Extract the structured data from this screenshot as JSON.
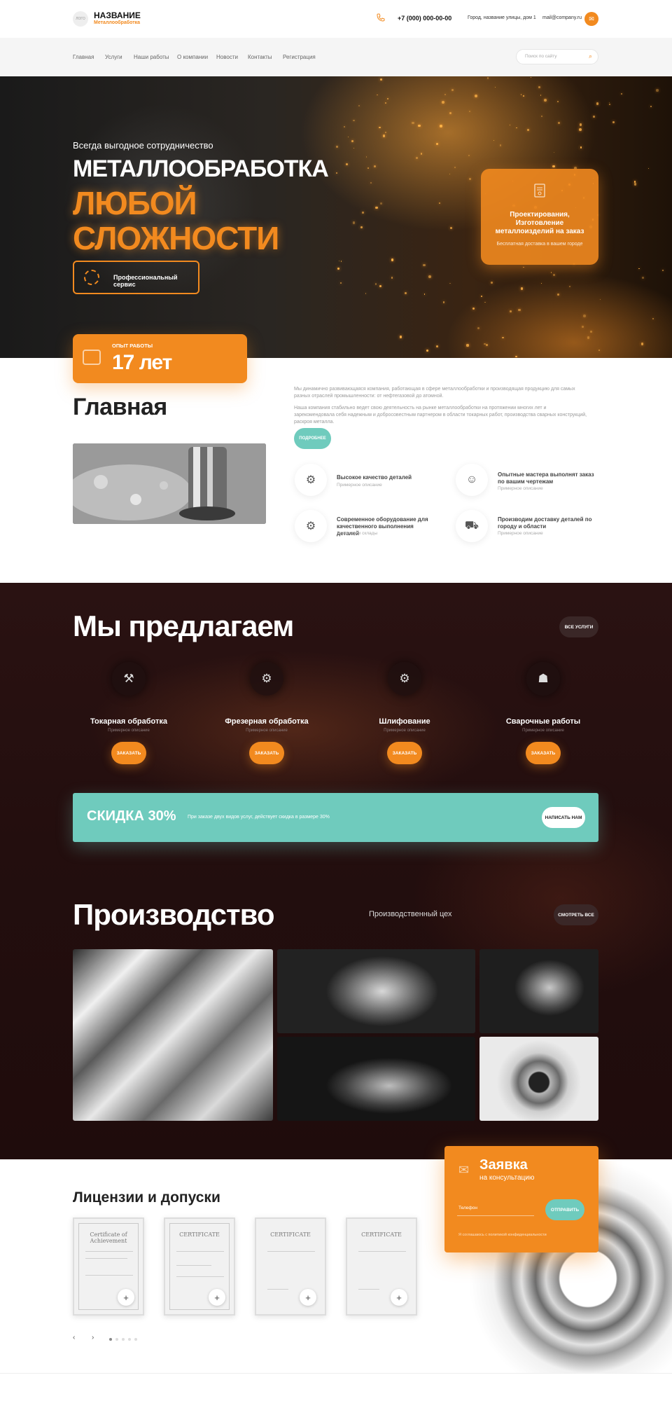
{
  "header": {
    "logo_text": "ЛОГО",
    "site_name": "НАЗВАНИЕ",
    "site_sub": "Металлообработка",
    "phone": "+7 (000) 000-00-00",
    "address": "Город, название улицы, дом 1",
    "email": "mail@company.ru"
  },
  "nav": {
    "items": [
      "Главная",
      "Услуги",
      "Наши работы",
      "О компании",
      "Новости",
      "Контакты",
      "Регистрация"
    ],
    "search_placeholder": "Поиск по сайту"
  },
  "hero": {
    "kicker": "Всегда выгодное сотрудничество",
    "title_line1": "МЕТАЛЛООБРАБОТКА",
    "title_line2": "ЛЮБОЙ",
    "title_line3": "СЛОЖНОСТИ",
    "button": "Профессиональный сервис",
    "card_title": "Проектирования, Изготовление металлоизделий на заказ",
    "card_sub": "Бесплатная доставка в вашем городе",
    "exp_label": "ОПЫТ РАБОТЫ",
    "exp_value": "17 лет"
  },
  "about": {
    "title": "Главная",
    "p1": "Мы динамично развивающаяся компания, работающая в сфере металлообработки и производящая продукцию для самых разных отраслей промышленности: от нефтегазовой до атомной.",
    "p2": "Наша компания стабильно ведет свою деятельность на рынке металлообработки на протяжении многих лет и зарекомендовала себя надежным и добросовестным партнером в области токарных работ, производства сварных конструкций, раскроя металла.",
    "more_button": "ПОДРОБНЕЕ",
    "features": [
      {
        "title": "Высокое качество деталей",
        "sub": "Примерное описание",
        "icon": "gears-icon"
      },
      {
        "title": "Опытные мастера выполнят заказ по вашим чертежам",
        "sub": "Примерное описание",
        "icon": "worker-icon"
      },
      {
        "title": "Современное оборудование для качественного выполнения деталей",
        "sub": "Элеватор и склады",
        "icon": "gear-icon"
      },
      {
        "title": "Производим доставку деталей по городу и области",
        "sub": "Примерное описание",
        "icon": "truck-icon"
      }
    ]
  },
  "services": {
    "title": "Мы предлагаем",
    "all_button": "ВСЕ УСЛУГИ",
    "items": [
      {
        "name": "Токарная обработка",
        "sub": "Примерное описание",
        "button": "ЗАКАЗАТЬ",
        "icon": "lathe-icon"
      },
      {
        "name": "Фрезерная обработка",
        "sub": "Примерное описание",
        "button": "ЗАКАЗАТЬ",
        "icon": "mill-icon"
      },
      {
        "name": "Шлифование",
        "sub": "Примерное описание",
        "button": "ЗАКАЗАТЬ",
        "icon": "grinder-icon"
      },
      {
        "name": "Сварочные работы",
        "sub": "Примерное описание",
        "button": "ЗАКАЗАТЬ",
        "icon": "welding-mask-icon"
      }
    ]
  },
  "promo": {
    "title": "СКИДКА 30%",
    "text": "При заказе двух видов услуг, действует скидка в размере 30%",
    "button": "НАПИСАТЬ НАМ"
  },
  "production": {
    "title": "Производство",
    "subtitle": "Производственный цех",
    "button": "СМОТРЕТЬ ВСЕ"
  },
  "licenses": {
    "title": "Лицензии и допуски",
    "certs": [
      "Certificate of Achievement",
      "CERTIFICATE",
      "CERTIFICATE",
      "CERTIFICATE"
    ],
    "prev": "‹",
    "next": "›"
  },
  "form": {
    "title": "Заявка",
    "subtitle": "на консультацию",
    "input_placeholder": "Телефон",
    "button": "ОТПРАВИТЬ",
    "agree": "Я соглашаюсь с политикой конфиденциальности"
  },
  "colors": {
    "accent": "#f28a1f",
    "teal": "#6fcbbd",
    "dark_bg": "#231010"
  }
}
